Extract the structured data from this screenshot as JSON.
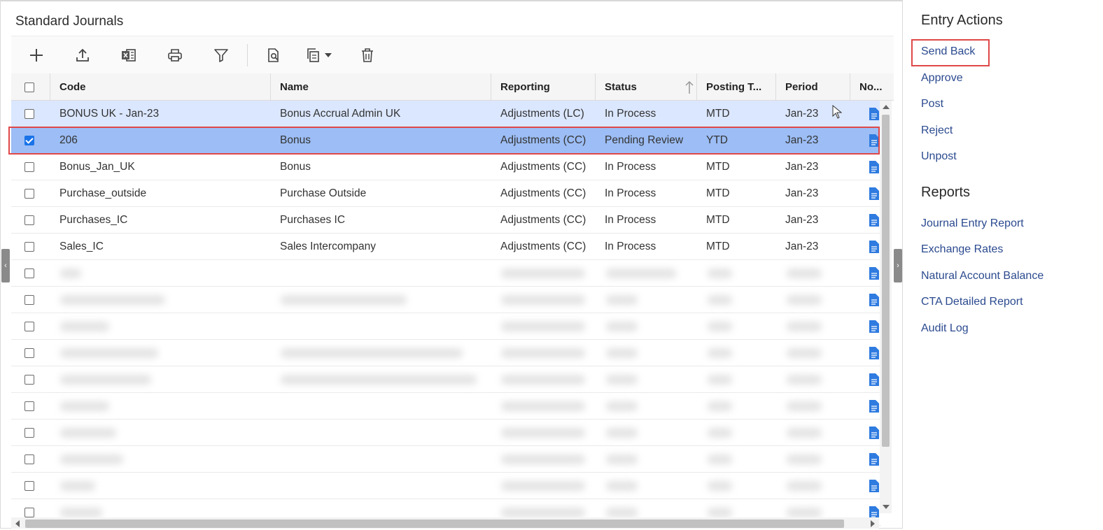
{
  "page": {
    "title": "Standard Journals"
  },
  "toolbar": {
    "buttons": [
      {
        "name": "add",
        "icon": "plus-icon"
      },
      {
        "name": "upload",
        "icon": "upload-icon"
      },
      {
        "name": "export-excel",
        "icon": "excel-icon"
      },
      {
        "name": "print",
        "icon": "print-icon"
      },
      {
        "name": "filter",
        "icon": "filter-icon"
      },
      {
        "name": "preview",
        "icon": "document-search-icon"
      },
      {
        "name": "copy",
        "icon": "copy-dropdown-icon"
      },
      {
        "name": "delete",
        "icon": "trash-icon"
      }
    ]
  },
  "grid": {
    "columns": [
      "Code",
      "Name",
      "Reporting",
      "Status",
      "Posting T...",
      "Period",
      "No..."
    ],
    "rows": [
      {
        "code": "BONUS UK - Jan-23",
        "name": "Bonus Accrual Admin UK",
        "reporting": "Adjustments (LC)",
        "status": "In Process",
        "posting": "MTD",
        "period": "Jan-23",
        "checked": false,
        "state": "hover"
      },
      {
        "code": "206",
        "name": "Bonus",
        "reporting": "Adjustments (CC)",
        "status": "Pending Review",
        "posting": "YTD",
        "period": "Jan-23",
        "checked": true,
        "state": "selected"
      },
      {
        "code": "Bonus_Jan_UK",
        "name": "Bonus",
        "reporting": "Adjustments (CC)",
        "status": "In Process",
        "posting": "MTD",
        "period": "Jan-23",
        "checked": false,
        "state": "normal"
      },
      {
        "code": "Purchase_outside",
        "name": "Purchase Outside",
        "reporting": "Adjustments (CC)",
        "status": "In Process",
        "posting": "MTD",
        "period": "Jan-23",
        "checked": false,
        "state": "normal"
      },
      {
        "code": "Purchases_IC",
        "name": "Purchases IC",
        "reporting": "Adjustments (CC)",
        "status": "In Process",
        "posting": "MTD",
        "period": "Jan-23",
        "checked": false,
        "state": "normal"
      },
      {
        "code": "Sales_IC",
        "name": "Sales Intercompany",
        "reporting": "Adjustments (CC)",
        "status": "In Process",
        "posting": "MTD",
        "period": "Jan-23",
        "checked": false,
        "state": "normal"
      }
    ],
    "blurred_row_count": 10,
    "sort_icon": "sort-ascending-icon"
  },
  "entry_actions": {
    "title": "Entry Actions",
    "items": [
      "Send Back",
      "Approve",
      "Post",
      "Reject",
      "Unpost"
    ]
  },
  "reports": {
    "title": "Reports",
    "items": [
      "Journal Entry Report",
      "Exchange Rates",
      "Natural Account Balance",
      "CTA Detailed Report",
      "Audit Log"
    ]
  },
  "colors": {
    "selected_row": "#9cbdf5",
    "hover_row": "#dbe7ff",
    "link": "#2b4a8f",
    "highlight_outline": "#e04848",
    "doc_icon": "#2f7be0"
  }
}
